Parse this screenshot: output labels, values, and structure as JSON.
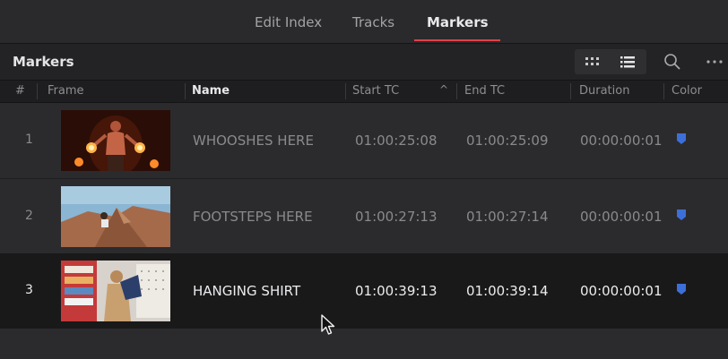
{
  "tabs": [
    {
      "label": "Edit Index",
      "active": false
    },
    {
      "label": "Tracks",
      "active": false
    },
    {
      "label": "Markers",
      "active": true
    }
  ],
  "panel": {
    "title": "Markers",
    "icons": {
      "grid_view": "grid-view-icon",
      "list_view": "list-view-icon",
      "search": "search-icon",
      "more": "more-options-icon"
    }
  },
  "columns": {
    "index": "#",
    "frame": "Frame",
    "name": "Name",
    "start_tc": "Start TC",
    "end_tc": "End TC",
    "duration": "Duration",
    "color": "Color",
    "sort_indicator": "^"
  },
  "rows": [
    {
      "index": "1",
      "name": "WHOOSHES HERE",
      "start_tc": "01:00:25:08",
      "end_tc": "01:00:25:09",
      "duration": "00:00:00:01",
      "marker_color": "#3d6fd9",
      "thumbnail": "fire-dancer-thumbnail",
      "selected": false
    },
    {
      "index": "2",
      "name": "FOOTSTEPS HERE",
      "start_tc": "01:00:27:13",
      "end_tc": "01:00:27:14",
      "duration": "00:00:00:01",
      "marker_color": "#3d6fd9",
      "thumbnail": "rock-climber-thumbnail",
      "selected": false
    },
    {
      "index": "3",
      "name": "HANGING SHIRT",
      "start_tc": "01:00:39:13",
      "end_tc": "01:00:39:14",
      "duration": "00:00:00:01",
      "marker_color": "#3d6fd9",
      "thumbnail": "shop-shirt-thumbnail",
      "selected": true
    }
  ],
  "colors": {
    "accent": "#e0424a",
    "marker_blue": "#3d6fd9",
    "selected_row": "#19191a"
  }
}
